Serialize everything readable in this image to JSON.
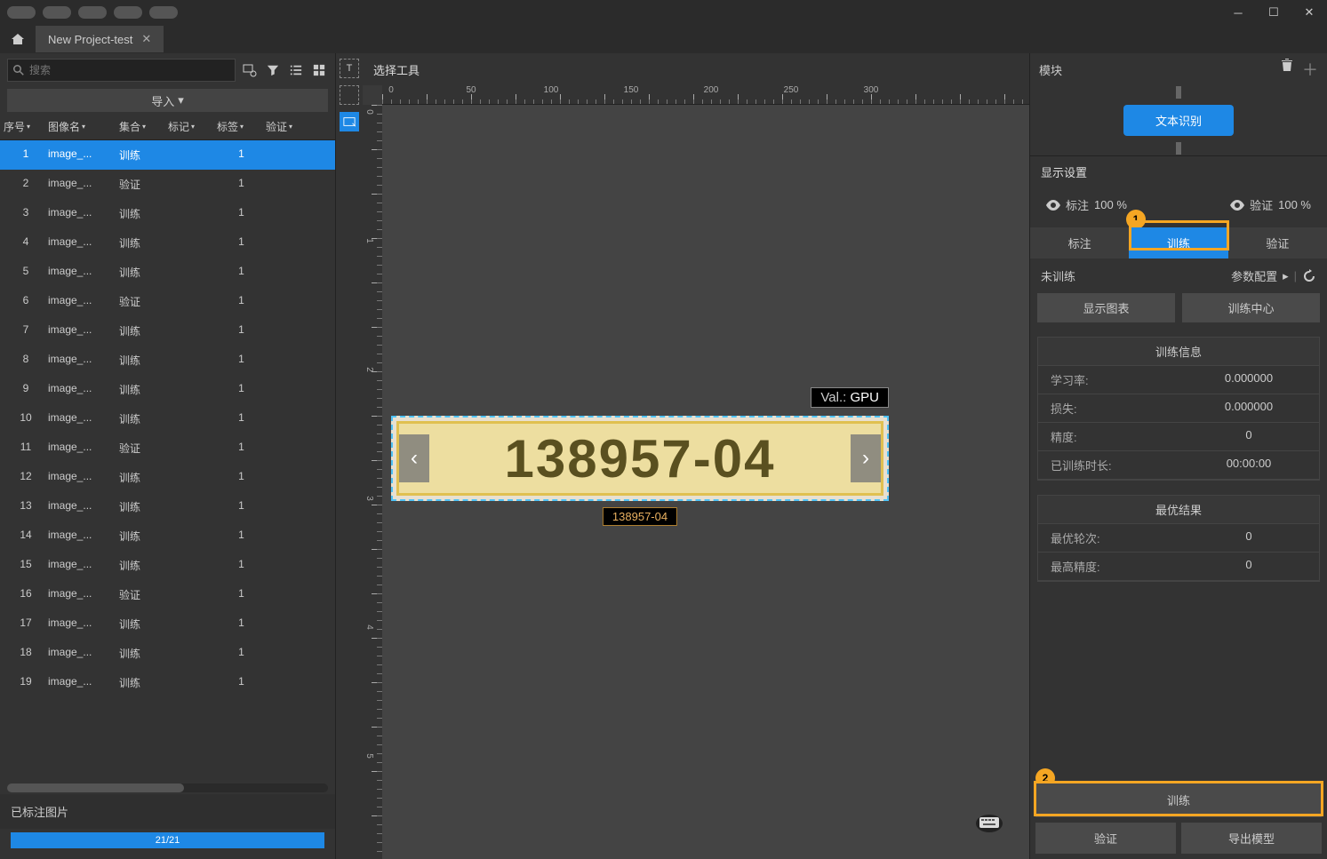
{
  "window": {
    "tab_title": "New Project-test"
  },
  "search": {
    "placeholder": "搜索"
  },
  "import_label": "导入",
  "columns": {
    "idx": "序号",
    "name": "图像名",
    "set": "集合",
    "mark": "标记",
    "tag": "标签",
    "val": "验证"
  },
  "rows": [
    {
      "idx": "1",
      "name": "image_...",
      "set": "训练",
      "tag": "1"
    },
    {
      "idx": "2",
      "name": "image_...",
      "set": "验证",
      "tag": "1"
    },
    {
      "idx": "3",
      "name": "image_...",
      "set": "训练",
      "tag": "1"
    },
    {
      "idx": "4",
      "name": "image_...",
      "set": "训练",
      "tag": "1"
    },
    {
      "idx": "5",
      "name": "image_...",
      "set": "训练",
      "tag": "1"
    },
    {
      "idx": "6",
      "name": "image_...",
      "set": "验证",
      "tag": "1"
    },
    {
      "idx": "7",
      "name": "image_...",
      "set": "训练",
      "tag": "1"
    },
    {
      "idx": "8",
      "name": "image_...",
      "set": "训练",
      "tag": "1"
    },
    {
      "idx": "9",
      "name": "image_...",
      "set": "训练",
      "tag": "1"
    },
    {
      "idx": "10",
      "name": "image_...",
      "set": "训练",
      "tag": "1"
    },
    {
      "idx": "11",
      "name": "image_...",
      "set": "验证",
      "tag": "1"
    },
    {
      "idx": "12",
      "name": "image_...",
      "set": "训练",
      "tag": "1"
    },
    {
      "idx": "13",
      "name": "image_...",
      "set": "训练",
      "tag": "1"
    },
    {
      "idx": "14",
      "name": "image_...",
      "set": "训练",
      "tag": "1"
    },
    {
      "idx": "15",
      "name": "image_...",
      "set": "训练",
      "tag": "1"
    },
    {
      "idx": "16",
      "name": "image_...",
      "set": "验证",
      "tag": "1"
    },
    {
      "idx": "17",
      "name": "image_...",
      "set": "训练",
      "tag": "1"
    },
    {
      "idx": "18",
      "name": "image_...",
      "set": "训练",
      "tag": "1"
    },
    {
      "idx": "19",
      "name": "image_...",
      "set": "训练",
      "tag": "1"
    }
  ],
  "labeled": {
    "title": "已标注图片",
    "progress": "21/21"
  },
  "canvas": {
    "toolbar_title": "选择工具",
    "val_prefix": "Val.:",
    "val_value": "GPU",
    "digits": "138957-04",
    "caption": "138957-04",
    "hticks": [
      "0",
      "50",
      "100",
      "150",
      "200",
      "250",
      "300"
    ],
    "vticks": [
      "0",
      "1",
      "2",
      "3",
      "4",
      "5"
    ]
  },
  "right": {
    "module": "模块",
    "chip": "文本识别",
    "display": "显示设置",
    "eye1_label": "标注",
    "eye1_pct": "100 %",
    "eye2_label": "验证",
    "eye2_pct": "100 %",
    "sub_label": "标注",
    "sub_train": "训练",
    "sub_val": "验证",
    "badge1": "1",
    "badge2": "2",
    "status": "未训练",
    "config": "参数配置",
    "show_chart": "显示图表",
    "train_center": "训练中心",
    "info_title": "训练信息",
    "info": [
      [
        "学习率:",
        "0.000000"
      ],
      [
        "损失:",
        "0.000000"
      ],
      [
        "精度:",
        "0"
      ],
      [
        "已训练时长:",
        "00:00:00"
      ]
    ],
    "best_title": "最优结果",
    "best": [
      [
        "最优轮次:",
        "0"
      ],
      [
        "最高精度:",
        "0"
      ]
    ],
    "train_btn": "训练",
    "val_btn": "验证",
    "export_btn": "导出模型"
  }
}
